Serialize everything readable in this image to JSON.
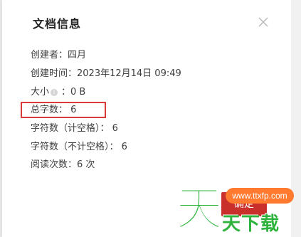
{
  "dialog": {
    "title": "文档信息",
    "close_icon": "close-icon",
    "info_icon": "info-icon",
    "info_icon_glyph": "i",
    "rows": {
      "creator": "创建者：四月",
      "created_time": "创建时间：2023年12月14日 09:49",
      "size_label": "大小",
      "size_value": "：0 B",
      "total_chars": "总字数： 6",
      "chars_with_spaces": "字符数（计空格）： 6",
      "chars_without_spaces": "字符数（不计空格）： 6",
      "read_count": "阅读次数：6 次"
    },
    "ok_button": "确定",
    "highlight_color": "#d93a3a",
    "button_color": "#c9302c"
  },
  "watermark": {
    "badge": "www.ttxfp.com",
    "logo_glyph": "天",
    "text": "天下载",
    "color": "#2eb33d",
    "badge_color": "#ff7a2f"
  }
}
